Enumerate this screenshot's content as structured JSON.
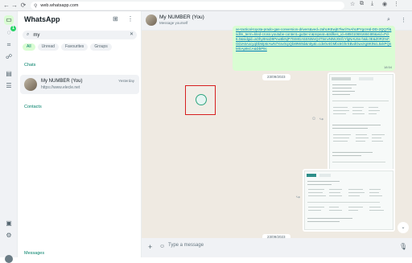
{
  "browser": {
    "url": "web.whatsapp.com"
  },
  "rail": {
    "unread_badge": "1"
  },
  "panel": {
    "title": "WhatsApp",
    "search": {
      "value": "my"
    },
    "filters": [
      "All",
      "Unread",
      "Favourites",
      "Groups"
    ],
    "sections": {
      "chats": "Chats",
      "contacts": "Contacts",
      "messages": "Messages"
    },
    "chat": {
      "name": "My NUMBER (You)",
      "time": "Yesterday",
      "preview": "https://www.elecle.net"
    }
  },
  "conversation": {
    "name": "My NUMBER (You)",
    "subtitle": "Message yourself",
    "link_message": {
      "text": "xe-tactical-toyota-prado-gas-conversion-drivers&ved=2ahUKEwjE7lwcl7eAhUPYgcIHd-DD-2QQ7f&sdlm_term=kled-cross-youtube-content=gutter-in&repeat=&tsllkes_id=685010691684485&eid=Pd-6.0&sidgid=aOhy8HaD9Pew8kNjP7tSMGA5SNWvQ4T5mvNtWJ0nfcYlgNAU5s-h&k.0E&Z0R3%F.GDiA6AxcyqDbMp6rAwN7Xsv0cpQb89W8d&ntty&t=cde0v4GMbc6GhrSBvdGwxXg8KtNcL5xkPQnMSAp8sCA&DbP9c",
      "time": "18:54"
    },
    "date_pills": [
      "23/09/2023",
      "23/09/2023"
    ],
    "image_times": [
      "",
      ""
    ],
    "compose_placeholder": "Type a message"
  }
}
